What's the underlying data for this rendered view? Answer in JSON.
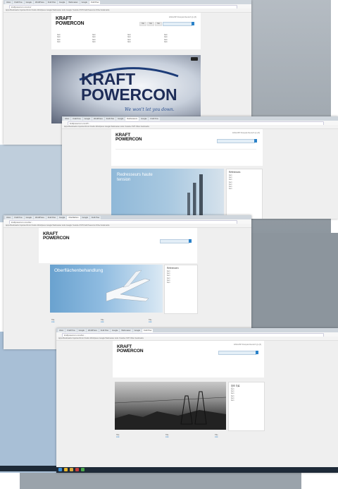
{
  "brand": {
    "line1": "KRAFT",
    "line2": "POWERCON"
  },
  "hero_banner": {
    "tagline": "We won't let you down."
  },
  "top_links": {
    "label": "ENGLISH  Français  Deutsch  한국어"
  },
  "shot1": {
    "tabs": [
      "Inbox",
      "Kraft Pow",
      "Google",
      "WordPress",
      "Kraft Pow",
      "Google",
      "Webmaster",
      "Google",
      "Kraft Pow"
    ],
    "url": "kraftpowercon.com/en/",
    "bookmarks": "Apps  Bookmarks  Imported From Firefox  Wordpress  Google  Webmaster tools  Google  Youtube  OVH  Kraft Powercon  Other bookmarks",
    "nav_buttons": [
      "Tab",
      "Tab",
      "Tab"
    ],
    "menu": [
      {
        "items": [
          "Item",
          "Item",
          "Item",
          "Item"
        ]
      },
      {
        "items": [
          "Item",
          "Item",
          "Item",
          "Item"
        ]
      },
      {
        "items": [
          "Item",
          "Item",
          "Item",
          "Item"
        ]
      },
      {
        "items": [
          "Item",
          "Item",
          "Item",
          "Item"
        ]
      }
    ]
  },
  "shot2": {
    "tabs": [
      "Inbox",
      "Kraft Pow",
      "Google",
      "WordPress",
      "Kraft Pow",
      "Google",
      "Redresseurs",
      "Google",
      "Kraft Pow"
    ],
    "url": "kraftpowercon.com/fr/...",
    "bookmarks": "Apps  Bookmarks  Imported From Firefox  Wordpress  Google  Webmaster tools  Youtube  OVH  Other bookmarks",
    "hero_title": "Redresseurs haute tension",
    "sidebar_title": "Références",
    "sidebar_items": [
      "Item",
      "Item",
      "Item",
      "Item",
      "Item",
      "Item",
      "Item"
    ]
  },
  "shot3": {
    "tabs": [
      "Inbox",
      "Kraft Pow",
      "Google",
      "WordPress",
      "Kraft Pow",
      "Google",
      "Oberflächen",
      "Google",
      "Kraft Pow"
    ],
    "url": "kraftpowercon.com/de/...",
    "hero_title": "Oberflächenbehandlung",
    "sidebar_title": "Referenzen",
    "sidebar_items": [
      "Item",
      "Item",
      "Item",
      "Item",
      "Item",
      "Item"
    ],
    "bottom_cols": [
      {
        "title": "Title",
        "link": "Link"
      },
      {
        "title": "Title",
        "link": "Link"
      },
      {
        "title": "Title",
        "link": "Link"
      }
    ]
  },
  "shot4": {
    "tabs": [
      "Inbox",
      "Kraft Pow",
      "Google",
      "WordPress",
      "Kraft Pow",
      "Google",
      "Webmaster",
      "Google",
      "Kraft Pow"
    ],
    "url": "kraftpowercon.com/ko/...",
    "sidebar_title": "참조 자료",
    "sidebar_items": [
      "Item",
      "Item",
      "Item",
      "Item",
      "Item",
      "Item"
    ],
    "bottom_cols": [
      {
        "title": "Title",
        "link": "Link"
      },
      {
        "title": "Title",
        "link": "Link"
      },
      {
        "title": "Title",
        "link": "Link"
      }
    ]
  },
  "colors": {
    "accent": "#2b82c9",
    "hero_blue": "#7fb0d6",
    "taskbar": "#1e2a38"
  }
}
